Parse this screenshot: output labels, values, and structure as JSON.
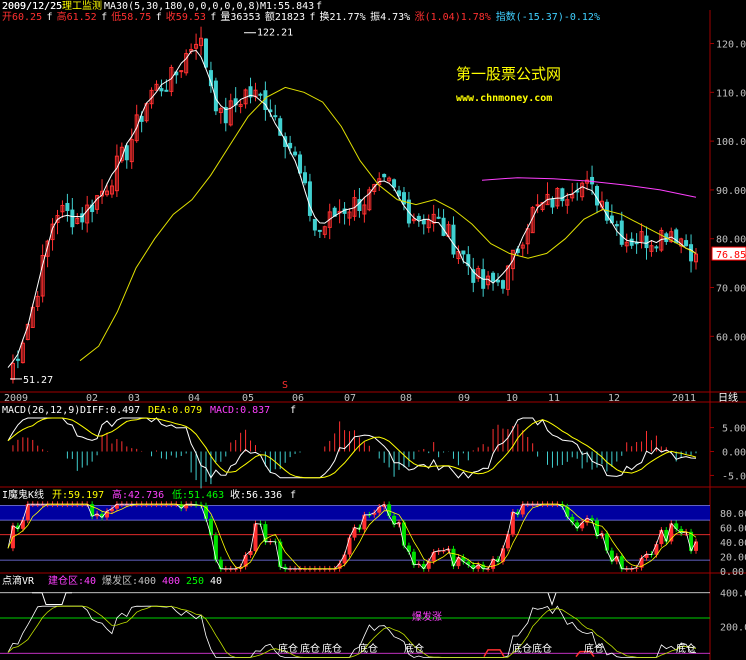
{
  "header": {
    "date": "2009/12/25",
    "title": "理工监测",
    "ma_label": "MA30(5,30,180,0,0,0,0,0,8)",
    "m1": "M1:55.843",
    "open": "开60.25",
    "high": "高61.52",
    "low": "低58.75",
    "close": "收59.53",
    "volume": "量36353",
    "amount": "额21823",
    "turnover": "换21.77%",
    "amplitude": "振4.73%",
    "change": "涨(1.04)1.78%",
    "index": "指数(-15.37)-0.12%",
    "flag": "f"
  },
  "watermark": {
    "line1": "第一股票公式网",
    "line2": "www.chnmoney.com"
  },
  "price_labels": {
    "high_marker": "122.21",
    "low_marker": "51.27",
    "current": "76.85"
  },
  "x_labels": [
    "2009",
    "02",
    "03",
    "04",
    "05",
    "06",
    "07",
    "08",
    "09",
    "10",
    "11",
    "12",
    "2011",
    "日线"
  ],
  "colors": {
    "up": "#ff3030",
    "down": "#40d0d0",
    "white_line": "#ffffff",
    "yellow_line": "#e0e000",
    "magenta_line": "#ff40ff",
    "blue_band": "#0000a0",
    "green_line": "#00d000",
    "price_box": "#ff0000"
  },
  "macd": {
    "label": "MACD(26,12,9)",
    "diff": "DIFF:0.497",
    "dea": "DEA:0.079",
    "macd": "MACD:0.837",
    "flag": "f"
  },
  "kd": {
    "label": "I魔鬼K线",
    "open": "开:59.197",
    "high": "高:42.736",
    "low": "低:51.463",
    "close": "收:56.336",
    "flag": "f"
  },
  "vr": {
    "label": "点滴VR",
    "l1": "建仓区:40",
    "l2": "爆发区:400",
    "v1": "400",
    "v2": "250",
    "v3": "40",
    "bottom_text": "底仓",
    "annotation": "爆发涨"
  },
  "chart_data": [
    {
      "type": "candlestick",
      "title": "",
      "x_ticks": [
        "2009",
        "02",
        "03",
        "04",
        "05",
        "06",
        "07",
        "08",
        "09",
        "10",
        "11",
        "12",
        "2011"
      ],
      "y_ticks": [
        60,
        70,
        80,
        90,
        100,
        110,
        120
      ],
      "ylim": [
        49,
        124
      ],
      "series": [
        {
          "name": "MA30",
          "values": [
            55,
            58,
            65,
            74,
            80,
            85,
            88,
            93,
            99,
            105,
            109,
            111,
            110,
            108,
            103,
            96,
            91,
            88,
            87,
            88,
            86,
            83,
            79,
            77,
            76,
            77,
            80,
            84,
            86,
            85,
            83,
            81,
            79,
            77
          ]
        },
        {
          "name": "close",
          "values": [
            51.27,
            65,
            86,
            84,
            90,
            98,
            110,
            113,
            122.21,
            104,
            110,
            108,
            98,
            81,
            86,
            88,
            91,
            85,
            84,
            78,
            70,
            72,
            85,
            88,
            92,
            88,
            80,
            80,
            82,
            76.85
          ]
        },
        {
          "name": "long MA",
          "values": [
            92,
            92.5,
            92.3,
            91.8,
            91,
            90,
            88.5
          ]
        }
      ],
      "annotations": {
        "max": 122.21,
        "min": 51.27,
        "last": 76.85
      }
    },
    {
      "type": "bar",
      "title": "MACD(26,12,9)",
      "y_ticks": [
        -5,
        0,
        5
      ],
      "series": [
        {
          "name": "DIFF",
          "last": 0.497
        },
        {
          "name": "DEA",
          "last": 0.079
        },
        {
          "name": "MACD",
          "last": 0.837
        }
      ]
    },
    {
      "type": "line",
      "title": "I魔鬼K线",
      "y_ticks": [
        0,
        20,
        40,
        60,
        80
      ],
      "values": {
        "open": 59.197,
        "high": 42.736,
        "low": 51.463,
        "close": 56.336
      }
    },
    {
      "type": "line",
      "title": "点滴VR",
      "y_ticks": [
        200,
        400
      ],
      "series": [
        {
          "name": "VR"
        },
        {
          "name": "建仓区",
          "level": 40
        },
        {
          "name": "爆发区",
          "level": 400
        }
      ]
    }
  ]
}
